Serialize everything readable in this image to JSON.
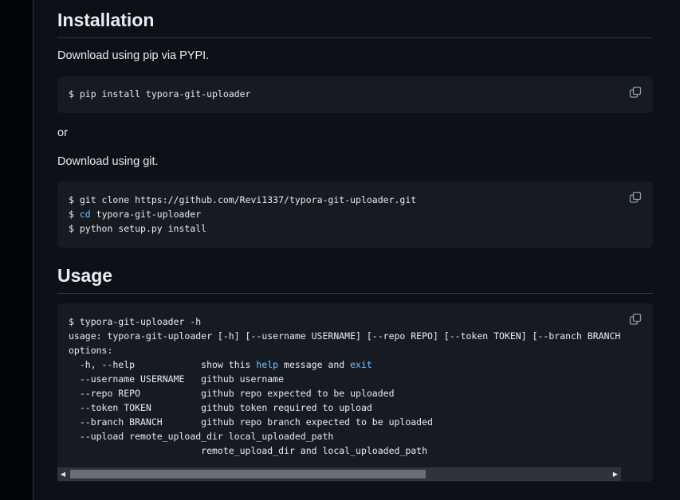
{
  "installation": {
    "heading": "Installation",
    "pip_intro": "Download using pip via PYPI.",
    "pip_command": "$ pip install typora-git-uploader",
    "or_text": "or",
    "git_intro": "Download using git.",
    "git_lines": [
      {
        "prompt": "$ ",
        "cmd": "",
        "rest": "git clone https://github.com/Revi1337/typora-git-uploader.git"
      },
      {
        "prompt": "$ ",
        "cmd": "cd",
        "rest": " typora-git-uploader"
      },
      {
        "prompt": "$ ",
        "cmd": "",
        "rest": "python setup.py install"
      }
    ]
  },
  "usage": {
    "heading": "Usage",
    "line1": "$ typora-git-uploader -h",
    "line2": "usage: typora-git-uploader [-h] [--username USERNAME] [--repo REPO] [--token TOKEN] [--branch BRANCH] [",
    "line3": "options:",
    "help_opt": "  -h, --help            show this ",
    "help_kw1": "help",
    "help_mid": " message and ",
    "help_kw2": "exit",
    "line5": "  --username USERNAME   github username",
    "line6": "  --repo REPO           github repo expected to be uploaded",
    "line7": "  --token TOKEN         github token required to upload",
    "line8": "  --branch BRANCH       github repo branch expected to be uploaded",
    "line9": "  --upload remote_upload_dir local_uploaded_path",
    "line10": "                        remote_upload_dir and local_uploaded_path"
  },
  "scrollbar": {
    "left_arrow": "◀",
    "right_arrow": "▶",
    "thumb_fraction": 0.66
  },
  "icons": {
    "copy": "copy-icon"
  },
  "colors": {
    "background": "#0d1117",
    "code_bg": "#161b22",
    "keyword": "#79c0ff"
  }
}
